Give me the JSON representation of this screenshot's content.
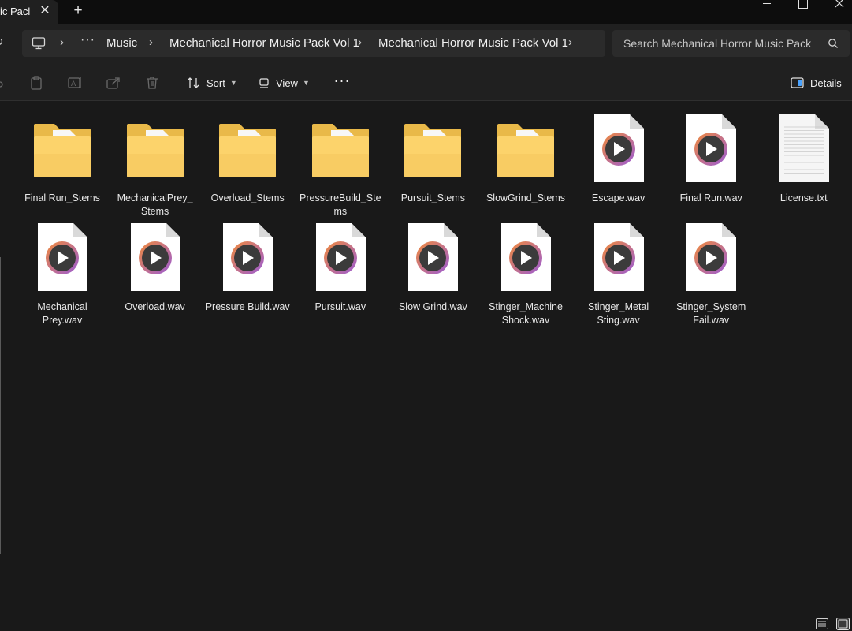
{
  "window": {
    "tab_title": "ic Pacl",
    "new_tab_label": "+"
  },
  "address": {
    "crumbs": [
      "Music",
      "Mechanical Horror Music Pack Vol 1",
      "Mechanical Horror Music Pack Vol 1"
    ],
    "more": "···"
  },
  "search": {
    "placeholder": "Search Mechanical Horror Music Pack"
  },
  "commandbar": {
    "sort_label": "Sort",
    "view_label": "View",
    "more_label": "···",
    "details_label": "Details"
  },
  "files": [
    {
      "name": "Final Run_Stems",
      "type": "folder"
    },
    {
      "name": "MechanicalPrey_ Stems",
      "type": "folder"
    },
    {
      "name": "Overload_Stems",
      "type": "folder"
    },
    {
      "name": "PressureBuild_Ste ms",
      "type": "folder"
    },
    {
      "name": "Pursuit_Stems",
      "type": "folder"
    },
    {
      "name": "SlowGrind_Stems",
      "type": "folder"
    },
    {
      "name": "Escape.wav",
      "type": "audio"
    },
    {
      "name": "Final Run.wav",
      "type": "audio"
    },
    {
      "name": "License.txt",
      "type": "text"
    },
    {
      "name": "Mechanical Prey.wav",
      "type": "audio"
    },
    {
      "name": "Overload.wav",
      "type": "audio"
    },
    {
      "name": "Pressure Build.wav",
      "type": "audio"
    },
    {
      "name": "Pursuit.wav",
      "type": "audio"
    },
    {
      "name": "Slow Grind.wav",
      "type": "audio"
    },
    {
      "name": "Stinger_Machine Shock.wav",
      "type": "audio"
    },
    {
      "name": "Stinger_Metal Sting.wav",
      "type": "audio"
    },
    {
      "name": "Stinger_System Fail.wav",
      "type": "audio"
    }
  ],
  "colors": {
    "folder_back": "#e9b949",
    "folder_front": "#fcd36b",
    "audio_ring_start": "#f08a3b",
    "audio_ring_end": "#9b5bd6"
  }
}
